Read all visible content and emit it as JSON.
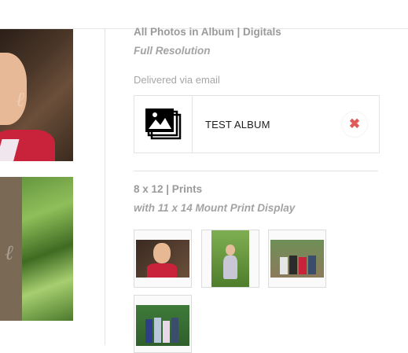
{
  "delivery": {
    "heading": "All Photos in Album | Digitals",
    "subheading": "Full Resolution",
    "method": "Delivered via email",
    "album": {
      "title": "TEST ALBUM",
      "icon": "image-stack-icon",
      "remove_icon": "close-icon",
      "remove_label": "✖"
    }
  },
  "prints": {
    "heading": "8 x 12 | Prints",
    "subheading": "with 11 x 14 Mount Print Display",
    "thumbnails": [
      {
        "name": "boy-portrait"
      },
      {
        "name": "girl-in-garden"
      },
      {
        "name": "family-seated"
      },
      {
        "name": "family-standing"
      }
    ]
  },
  "colors": {
    "accent_remove": "#e05a5a",
    "heading_gray": "#9a9a9a",
    "border": "#e3e3e3"
  }
}
